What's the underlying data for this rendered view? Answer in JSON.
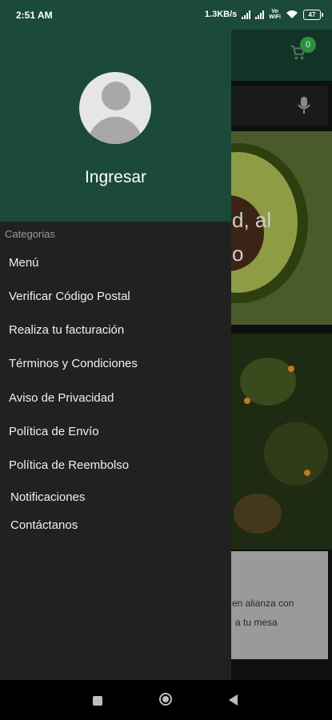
{
  "status_bar": {
    "time": "2:51 AM",
    "speed": "1.3KB/s",
    "vowifi": "Vo\nWiFi",
    "battery": "47"
  },
  "background": {
    "cart_count": "0",
    "banner_text": "d, al\no",
    "card_text_line1": "en alianza con",
    "card_text_line2": "a tu mesa"
  },
  "drawer": {
    "login_label": "Ingresar",
    "section_title": "Categorias",
    "items": [
      {
        "label": "Menú"
      },
      {
        "label": "Verificar Código Postal"
      },
      {
        "label": "Realiza tu facturación"
      },
      {
        "label": "Términos y Condiciones"
      },
      {
        "label": "Aviso de Privacidad"
      },
      {
        "label": "Política de Envío"
      },
      {
        "label": "Política de Reembolso"
      },
      {
        "label": "Notificaciones"
      },
      {
        "label": "Contáctanos"
      }
    ]
  },
  "colors": {
    "drawer_header": "#1b4a38",
    "drawer_body": "#212121",
    "badge": "#2e8f3e"
  },
  "icons": {
    "cart": "shopping-cart-icon",
    "mic": "microphone-icon",
    "avatar": "user-avatar-icon",
    "nav_recent": "square-icon",
    "nav_home": "circle-icon",
    "nav_back": "triangle-back-icon"
  }
}
